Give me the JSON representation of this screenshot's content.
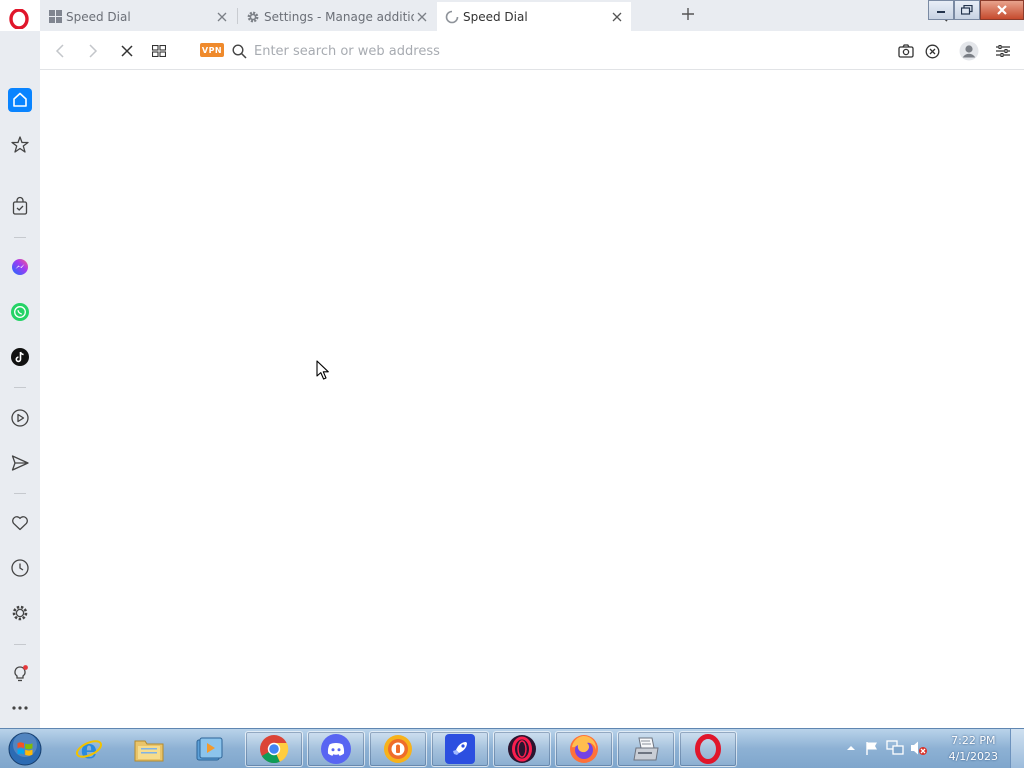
{
  "browser": {
    "tabs": [
      {
        "title": "Speed Dial",
        "active": false,
        "favicon": "speed-dial-icon"
      },
      {
        "title": "Settings - Manage additio",
        "active": false,
        "favicon": "gear-icon"
      },
      {
        "title": "Speed Dial",
        "active": true,
        "favicon": "loading-spinner-icon"
      }
    ],
    "address": {
      "placeholder": "Enter search or web address",
      "value": ""
    },
    "vpn_label": "VPN"
  },
  "sidebar": {
    "items": [
      "home",
      "pinboards",
      "shopping",
      "messenger",
      "whatsapp",
      "tiktok",
      "player",
      "send",
      "favorites",
      "history",
      "settings",
      "ideas",
      "more"
    ],
    "accent": "#0a84ff"
  },
  "taskbar": {
    "apps": [
      "internet-explorer",
      "file-explorer",
      "media-center",
      "chrome",
      "discord",
      "vpn-app",
      "rocket-app",
      "opera-gx",
      "firefox",
      "fax-scanner",
      "opera"
    ],
    "clock": {
      "time": "7:22 PM",
      "date": "4/1/2023"
    }
  }
}
